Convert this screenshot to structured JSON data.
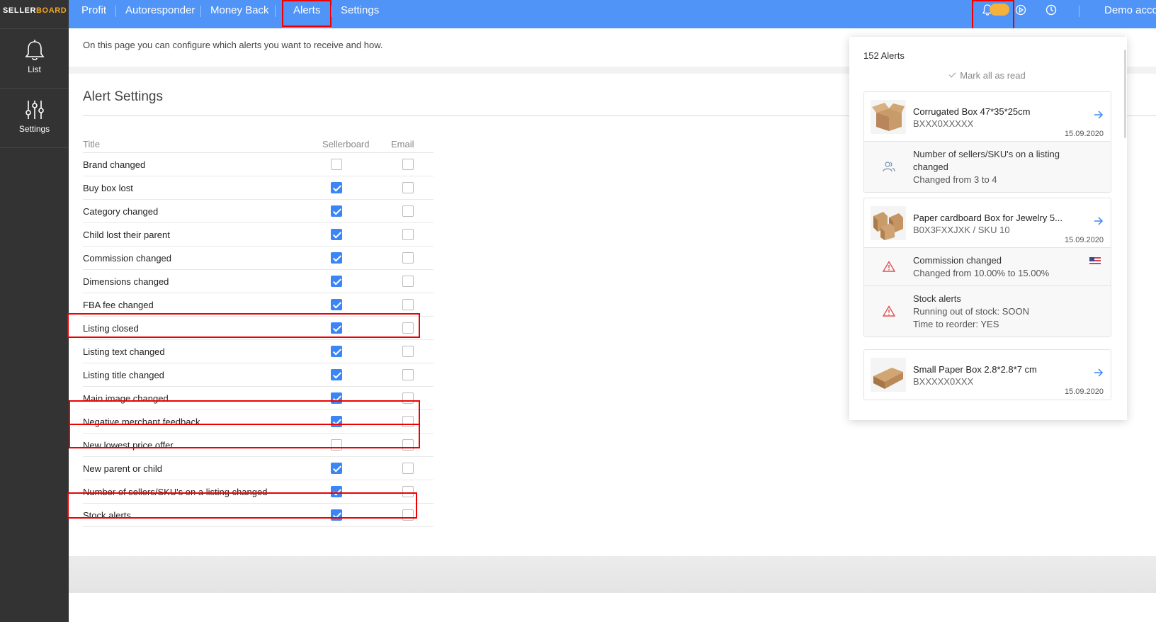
{
  "logo": {
    "part1": "SELLER",
    "part2": "BOARD"
  },
  "sidebar": {
    "items": [
      {
        "label": "List",
        "icon": "bell-icon"
      },
      {
        "label": "Settings",
        "icon": "sliders-icon"
      }
    ]
  },
  "topnav": {
    "items": [
      "Profit",
      "Autoresponder",
      "Money Back",
      "Alerts",
      "Settings"
    ],
    "active": "Alerts",
    "user": "Demo account"
  },
  "info": {
    "text": "On this page you can configure which alerts you want to receive and how."
  },
  "alert_settings": {
    "title": "Alert Settings",
    "columns": {
      "title": "Title",
      "sellerboard": "Sellerboard",
      "email": "Email"
    },
    "rows": [
      {
        "title": "Brand changed",
        "sellerboard": false,
        "email": false
      },
      {
        "title": "Buy box lost",
        "sellerboard": true,
        "email": false
      },
      {
        "title": "Category changed",
        "sellerboard": true,
        "email": false
      },
      {
        "title": "Child lost their parent",
        "sellerboard": true,
        "email": false
      },
      {
        "title": "Commission changed",
        "sellerboard": true,
        "email": false
      },
      {
        "title": "Dimensions changed",
        "sellerboard": true,
        "email": false
      },
      {
        "title": "FBA fee changed",
        "sellerboard": true,
        "email": false
      },
      {
        "title": "Listing closed",
        "sellerboard": true,
        "email": false
      },
      {
        "title": "Listing text changed",
        "sellerboard": true,
        "email": false
      },
      {
        "title": "Listing title changed",
        "sellerboard": true,
        "email": false
      },
      {
        "title": "Main image changed",
        "sellerboard": true,
        "email": false
      },
      {
        "title": "Negative merchant feedback",
        "sellerboard": true,
        "email": false
      },
      {
        "title": "New lowest price offer",
        "sellerboard": false,
        "email": false
      },
      {
        "title": "New parent or child",
        "sellerboard": true,
        "email": false
      },
      {
        "title": "Number of sellers/SKU's on a listing changed",
        "sellerboard": true,
        "email": false
      },
      {
        "title": "Stock alerts",
        "sellerboard": true,
        "email": false
      }
    ]
  },
  "notifications": {
    "count": "152 Alerts",
    "mark_all": "Mark all as read",
    "groups": [
      {
        "product": {
          "name": "Corrugated Box 47*35*25cm",
          "sku": "BXXX0XXXXX",
          "date": "15.09.2020"
        },
        "events": [
          {
            "icon": "users-icon",
            "lines": [
              "Number of sellers/SKU's on a listing",
              "changed",
              "Changed from 3 to 4"
            ]
          }
        ]
      },
      {
        "product": {
          "name": "Paper cardboard Box for Jewelry 5...",
          "sku": "B0X3FXXJXK / SKU 10",
          "date": "15.09.2020"
        },
        "events": [
          {
            "icon": "warning-icon",
            "lines": [
              "Commission changed",
              "Changed from 10.00% to 15.00%"
            ],
            "flag": "us-flag-icon"
          },
          {
            "icon": "warning-icon",
            "lines": [
              "Stock alerts",
              "Running out of stock: SOON",
              "Time to reorder: YES"
            ]
          }
        ]
      },
      {
        "product": {
          "name": "Small Paper Box 2.8*2.8*7 cm",
          "sku": "BXXXXX0XXX",
          "date": "15.09.2020"
        },
        "events": []
      }
    ]
  },
  "colors": {
    "topbar": "#4f94f6",
    "sidebar": "#333333",
    "checkbox_on": "#3b86f7",
    "highlight": "#ee0000",
    "toggle": "#f5b13d"
  }
}
